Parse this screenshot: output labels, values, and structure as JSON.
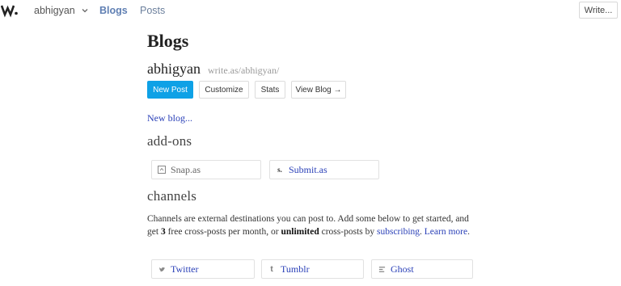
{
  "nav": {
    "logo_text": "W",
    "username": "abhigyan",
    "blogs_label": "Blogs",
    "posts_label": "Posts",
    "write_label": "Write..."
  },
  "page": {
    "title": "Blogs"
  },
  "blog": {
    "name": "abhigyan",
    "url": "write.as/abhigyan/",
    "buttons": {
      "new_post": "New Post",
      "customize": "Customize",
      "stats": "Stats",
      "view_blog": "View Blog →"
    },
    "new_blog_link": "New blog..."
  },
  "addons": {
    "title": "add-ons",
    "items": [
      {
        "label": "Snap.as",
        "icon": "snap-icon"
      },
      {
        "label": "Submit.as",
        "icon": "submit-s-icon"
      }
    ]
  },
  "channels": {
    "title": "channels",
    "desc_1": "Channels are external destinations you can post to. Add some below to get started, and get ",
    "free_count": "3",
    "desc_2": " free cross-posts per month, or ",
    "unlimited": "unlimited",
    "desc_3": " cross-posts by ",
    "subscribing": "subscribing",
    "desc_4": ". ",
    "learn_more": "Learn more",
    "desc_5": ".",
    "items": [
      {
        "label": "Twitter",
        "icon": "twitter-icon"
      },
      {
        "label": "Tumblr",
        "icon": "tumblr-icon"
      },
      {
        "label": "Ghost",
        "icon": "ghost-icon"
      }
    ]
  },
  "colors": {
    "accent": "#0ea1e6",
    "link": "#2b41b8",
    "nav_active": "#5f7fb3"
  }
}
